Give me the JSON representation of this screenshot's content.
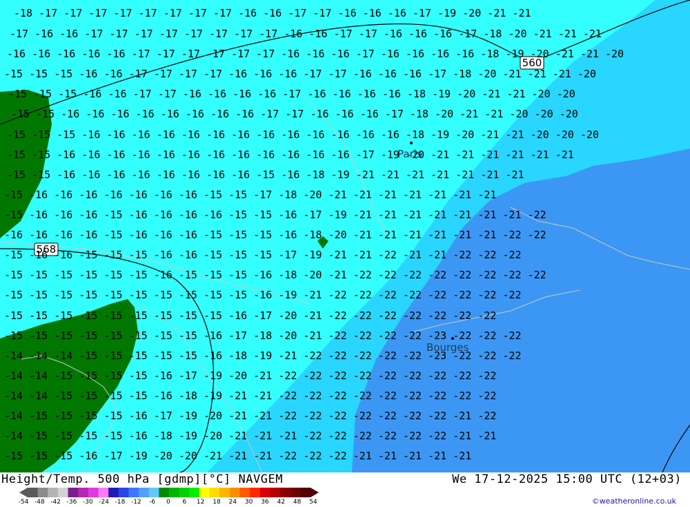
{
  "map": {
    "colors": {
      "cyan_light": "#33ffff",
      "cyan_mid": "#28d6ff",
      "blue": "#3c97f4",
      "green": "#007800",
      "coast": "#c8c8c8",
      "label": "#000000"
    },
    "contour_labels": [
      "560",
      "568"
    ],
    "places": [
      "Paris",
      "Bourges"
    ],
    "temperature_rows": [
      "-18 -17 -17 -17 -17 -17 -17 -17 -17 -16 -16 -17 -17 -16 -16 -16 -17 -19 -20 -21 -21",
      "-17 -16 -16 -17 -17 -17 -17 -17 -17 -17 -17 -16 -16 -17 -17 -16 -16 -16 -17 -18 -20 -21 -21 -21",
      "-16 -16 -16 -16 -16 -17 -17 -17 -17 -17 -17 -16 -16 -16 -17 -16 -16 -16 -16 -18 -19 -20 -21 -21 -20",
      "-15 -15 -15 -16 -16 -17 -17 -17 -17 -16 -16 -16 -17 -17 -16 -16 -16 -17 -18 -20 -21 -21 -21 -20",
      "-15 -15 -15 -16 -16 -17 -17 -16 -16 -16 -16 -17 -16 -16 -16 -16 -18 -19 -20 -21 -21 -20 -20",
      "-15 -15 -16 -16 -16 -16 -16 -16 -16 -16 -17 -17 -16 -16 -16 -17 -18 -20 -21 -21 -20 -20 -20",
      "-15 -15 -15 -16 -16 -16 -16 -16 -16 -16 -16 -16 -16 -16 -16 -16 -18 -19 -20 -21 -21 -20 -20 -20",
      "-15 -15 -16 -16 -16 -16 -16 -16 -16 -16 -16 -16 -16 -16 -17 -19 -20 -21 -21 -21 -21 -21 -21",
      "-15 -15 -16 -16 -16 -16 -16 -16 -16 -16 -15 -16 -18 -19 -21 -21 -21 -21 -21 -21 -21",
      "-15 -16 -16 -16 -16 -16 -16 -16 -15 -15 -17 -18 -20 -21 -21 -21 -21 -21 -21 -21",
      "-15 -16 -16 -16 -15 -16 -16 -16 -16 -15 -15 -16 -17 -19 -21 -21 -21 -21 -21 -21 -21 -22",
      "-16 -16 -16 -16 -15 -16 -16 -16 -15 -15 -15 -16 -18 -20 -21 -21 -21 -21 -21 -21 -22 -22",
      "-15 -16 -16 -15 -15 -15 -16 -16 -15 -15 -15 -17 -19 -21 -21 -22 -21 -21 -22 -22 -22",
      "-15 -15 -15 -15 -15 -15 -16 -15 -15 -15 -16 -18 -20 -21 -22 -22 -22 -22 -22 -22 -22 -22",
      "-15 -15 -15 -15 -15 -15 -15 -15 -15 -15 -16 -19 -21 -22 -22 -22 -22 -22 -22 -22 -22",
      "-15 -15 -15 -15 -15 -15 -15 -15 -15 -16 -17 -20 -21 -22 -22 -22 -22 -22 -22 -22",
      "-15 -15 -15 -15 -15 -15 -15 -15 -16 -17 -18 -20 -21 -22 -22 -22 -22 -23 -22 -22 -22",
      "-14 -14 -14 -15 -15 -15 -15 -15 -16 -18 -19 -21 -22 -22 -22 -22 -22 -23 -22 -22 -22",
      "-14 -14 -15 -15 -15 -15 -16 -17 -19 -20 -21 -22 -22 -22 -22 -22 -22 -22 -22 -22",
      "-14 -14 -15 -15 -15 -15 -16 -18 -19 -21 -21 -22 -22 -22 -22 -22 -22 -22 -22 -22",
      "-14 -15 -15 -15 -15 -16 -17 -19 -20 -21 -21 -22 -22 -22 -22 -22 -22 -22 -21 -22",
      "-14 -15 -15 -15 -15 -16 -18 -19 -20 -21 -21 -21 -22 -22 -22 -22 -22 -22 -21 -21",
      "-15 -15 -15 -16 -17 -19 -20 -20 -21 -21 -21 -22 -22 -22 -21 -21 -21 -21 -21"
    ]
  },
  "footer": {
    "title_left": "Height/Temp. 500 hPa [gdmp][°C] NAVGEM",
    "title_right": "We 17-12-2025 15:00 UTC (12+03)",
    "credit": "©weatheronline.co.uk",
    "legend_ticks": [
      "-54",
      "-48",
      "-42",
      "-36",
      "-30",
      "-24",
      "-18",
      "-12",
      "-6",
      "0",
      "6",
      "12",
      "18",
      "24",
      "30",
      "36",
      "42",
      "48",
      "54"
    ],
    "legend_colors": [
      "#5a5a5a",
      "#8c8c8c",
      "#b4b4b4",
      "#d2d2d2",
      "#7a1e8c",
      "#b428b4",
      "#dc3cdc",
      "#ff78ff",
      "#1e1eb4",
      "#2846e6",
      "#3c78ff",
      "#50a0ff",
      "#64c8ff",
      "#008c00",
      "#00b400",
      "#00d200",
      "#00f000",
      "#ffff00",
      "#ffdc00",
      "#ffb400",
      "#ff8c00",
      "#ff5a00",
      "#ff2800",
      "#dc0000",
      "#b40000",
      "#8c0000",
      "#6e0000",
      "#500000"
    ]
  }
}
